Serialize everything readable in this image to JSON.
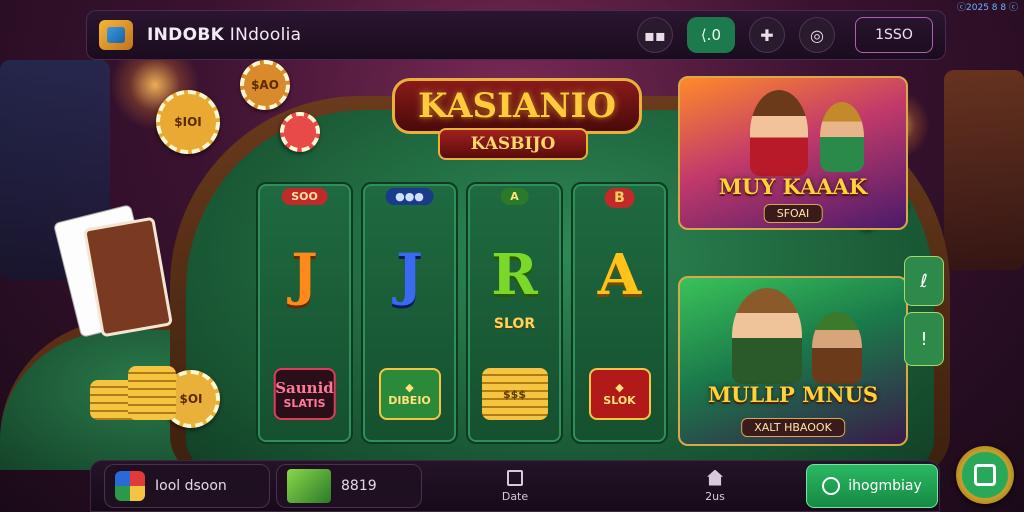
{
  "corner_tag": "ⓒ2025 8 8 ⓒ",
  "topbar": {
    "brand_bold": "INDOBK",
    "brand_rest": " INdoolia",
    "btn1_icon": "▪▪",
    "balance": "⟨.0",
    "btn2_icon": "✚",
    "btn3_icon": "◎",
    "outline_label": "1SSO"
  },
  "logo": {
    "main": "KASIANIO",
    "sub": "KASBIJO"
  },
  "reels": [
    {
      "top": "SOO",
      "letter": "J",
      "mid": "",
      "badge1": "Saunid",
      "badge2": "SLATIS"
    },
    {
      "top": "●●●",
      "letter": "J",
      "mid": "",
      "badge1": "◆",
      "badge2": "DIBEIO"
    },
    {
      "top": "A",
      "letter": "R",
      "mid": "SLOR",
      "badge1": "$$$",
      "badge2": ""
    },
    {
      "top": "B",
      "letter": "A",
      "mid": "",
      "badge1": "◆",
      "badge2": "SLOK"
    }
  ],
  "promos": {
    "card1_title": "MUY KAAAK",
    "card1_sub": "SFOAI",
    "card2_title": "MULLP MNUS",
    "card2_sub": "XALT HBAOOK"
  },
  "side_buttons": [
    "ℓ",
    "!"
  ],
  "chips": {
    "chip1": "$IOI",
    "chip2": "$AO",
    "chip3": "$OI"
  },
  "bottombar": {
    "item1_label": "Iool dsoon",
    "item2_label": "8819",
    "nav1_label": "Date",
    "nav2_label": "2us",
    "cta_label": "ihogmbiay"
  },
  "colors": {
    "accent_green": "#1d7a4c",
    "gold": "#ffcb3c",
    "felt": "#2e8a56",
    "background": "#3a1230"
  },
  "icons": [
    "folder-logo-icon",
    "grid-icon",
    "plus-icon",
    "target-icon",
    "gallery-icon",
    "home-icon",
    "chat-icon",
    "square-icon"
  ]
}
